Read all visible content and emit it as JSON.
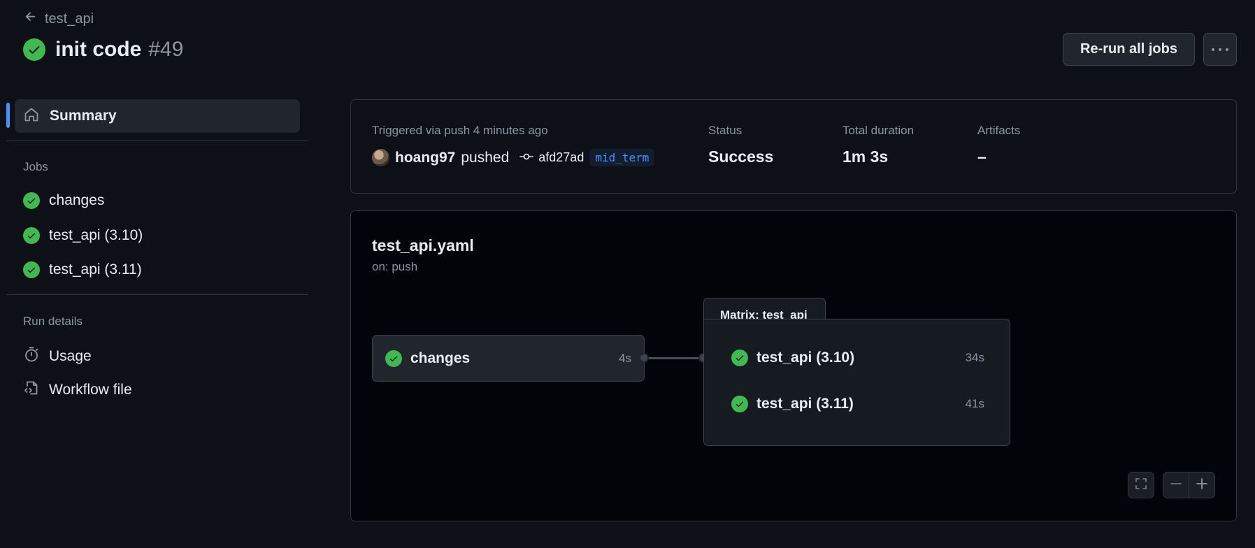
{
  "header": {
    "back_label": "test_api",
    "title": "init code",
    "run_number": "#49",
    "rerun_label": "Re-run all jobs"
  },
  "sidebar": {
    "summary_label": "Summary",
    "jobs_heading": "Jobs",
    "jobs": [
      {
        "label": "changes",
        "status": "success"
      },
      {
        "label": "test_api (3.10)",
        "status": "success"
      },
      {
        "label": "test_api (3.11)",
        "status": "success"
      }
    ],
    "run_details_heading": "Run details",
    "usage_label": "Usage",
    "workflow_file_label": "Workflow file"
  },
  "summary": {
    "triggered_text": "Triggered via push 4 minutes ago",
    "actor": "hoang97",
    "action": "pushed",
    "commit_sha": "afd27ad",
    "branch": "mid_term",
    "status_label": "Status",
    "status_value": "Success",
    "duration_label": "Total duration",
    "duration_value": "1m 3s",
    "artifacts_label": "Artifacts",
    "artifacts_value": "–"
  },
  "graph": {
    "workflow_name": "test_api.yaml",
    "trigger": "on: push",
    "job": {
      "name": "changes",
      "time": "4s"
    },
    "matrix_label": "Matrix: test_api",
    "matrix_jobs": [
      {
        "name": "test_api (3.10)",
        "time": "34s"
      },
      {
        "name": "test_api (3.11)",
        "time": "41s"
      }
    ]
  },
  "colors": {
    "success": "#3fb950",
    "accent": "#4493f8",
    "background": "#0d1117"
  }
}
